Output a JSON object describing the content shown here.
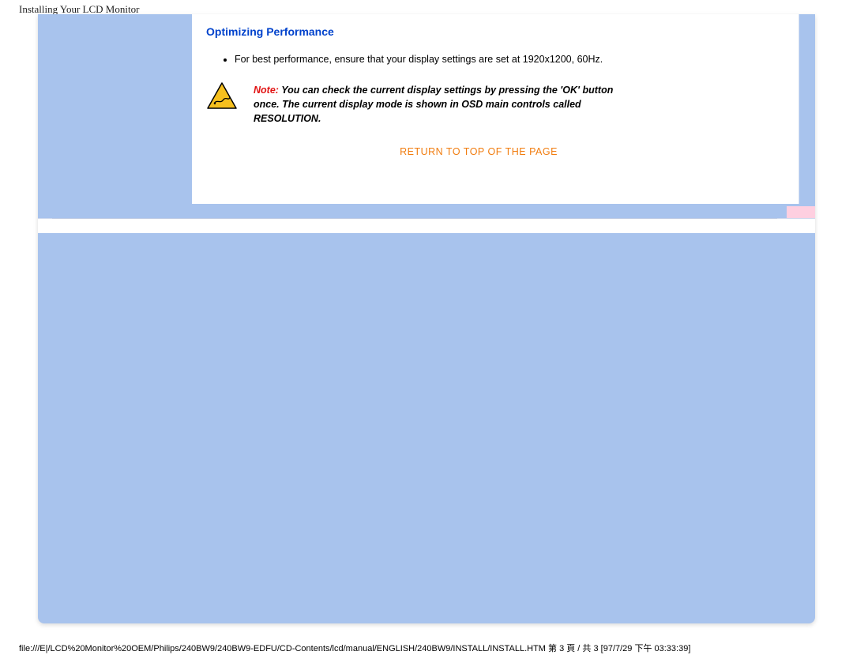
{
  "header": {
    "title": "Installing Your LCD Monitor"
  },
  "content": {
    "section_title": "Optimizing Performance",
    "bullet_item": "For best performance, ensure that your display settings are set at 1920x1200, 60Hz.",
    "note_label": "Note:",
    "note_body": " You can check the current display settings by pressing the 'OK' button once. The current display mode is shown in OSD main controls called RESOLUTION.",
    "return_link": "RETURN TO TOP OF THE PAGE"
  },
  "footer": {
    "path": "file:///E|/LCD%20Monitor%20OEM/Philips/240BW9/240BW9-EDFU/CD-Contents/lcd/manual/ENGLISH/240BW9/INSTALL/INSTALL.HTM 第 3 頁 / 共 3 [97/7/29 下午 03:33:39]"
  },
  "colors": {
    "bg_blue": "#a8c3ed",
    "title_blue": "#0042cc",
    "link_orange": "#f17d10",
    "note_red": "#e11313"
  }
}
